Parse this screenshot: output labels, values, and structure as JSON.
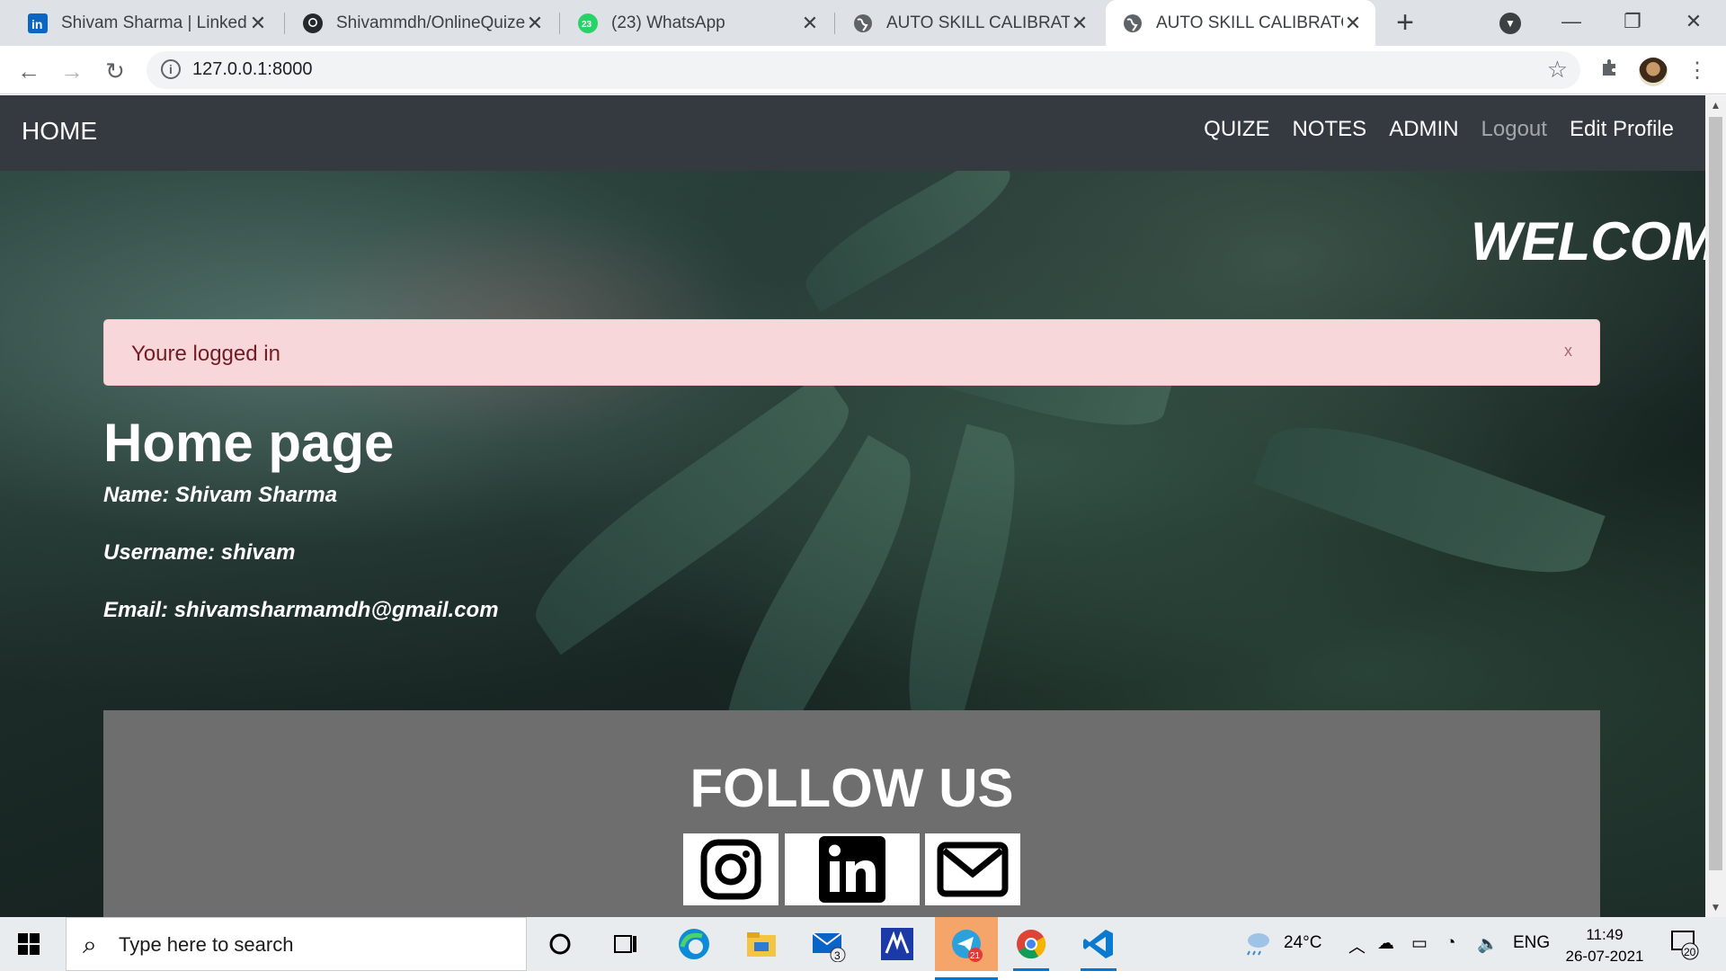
{
  "browser": {
    "tabs": [
      {
        "title": "Shivam Sharma | LinkedIn",
        "favicon": "linkedin-icon",
        "active": false
      },
      {
        "title": "Shivammdh/OnlineQuizeS",
        "favicon": "github-icon",
        "active": false
      },
      {
        "title": "(23) WhatsApp",
        "favicon": "whatsapp-icon",
        "badge": "23",
        "active": false
      },
      {
        "title": "AUTO SKILL CALIBRATOR",
        "favicon": "globe-icon",
        "active": false
      },
      {
        "title": "AUTO SKILL CALIBRATOR",
        "favicon": "globe-icon",
        "active": true
      }
    ],
    "url": "127.0.0.1:8000"
  },
  "page": {
    "brand": "HOME",
    "nav": [
      "QUIZE",
      "NOTES",
      "ADMIN",
      "Logout",
      "Edit Profile"
    ],
    "welcome": "WELCOME",
    "alert": {
      "message": "Youre logged in",
      "close": "x"
    },
    "title": "Home page",
    "name_line": "Name: Shivam Sharma",
    "username_line": "Username: shivam",
    "email_line": "Email: shivamsharmamdh@gmail.com",
    "footer": {
      "heading": "FOLLOW US",
      "social": [
        "instagram-icon",
        "linkedin-icon",
        "mail-icon"
      ]
    }
  },
  "taskbar": {
    "search_placeholder": "Type here to search",
    "mail_badge": "3",
    "telegram_badge": "21",
    "weather": "24°C",
    "language": "ENG",
    "time": "11:49",
    "date": "26-07-2021",
    "notifications": "20"
  },
  "colors": {
    "navbar": "#343a40",
    "alert_bg": "#f8d7da",
    "alert_text": "#721c24",
    "footer_bg": "#6e6e6e"
  }
}
